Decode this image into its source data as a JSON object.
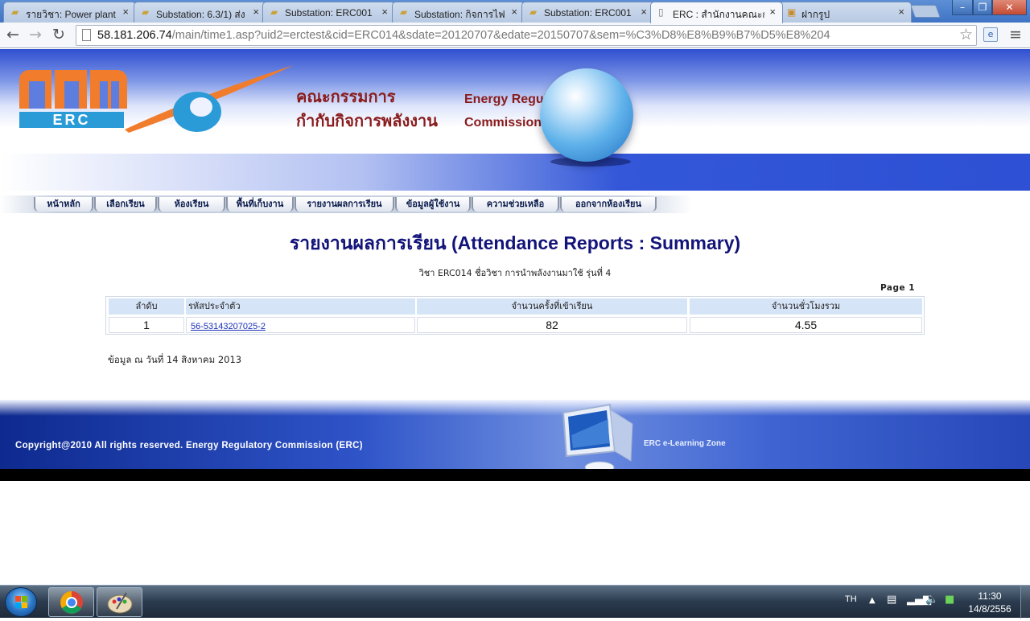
{
  "browser": {
    "tabs": [
      {
        "title": "รายวิชา: Power plant",
        "icon": "folder-icon"
      },
      {
        "title": "Substation: 6.3/1) ส่ง",
        "icon": "folder-icon"
      },
      {
        "title": "Substation: ERC001",
        "icon": "folder-icon"
      },
      {
        "title": "Substation: กิจการไฟ",
        "icon": "folder-icon"
      },
      {
        "title": "Substation: ERC001",
        "icon": "folder-icon"
      },
      {
        "title": "ERC : สำนักงานคณะก",
        "icon": "page-icon"
      },
      {
        "title": "ฝากรูป",
        "icon": "site-icon"
      }
    ],
    "active_tab": 5,
    "close_glyph": "×",
    "window_controls": {
      "minimize": "–",
      "restore": "❐",
      "close": "✕"
    },
    "url_host": "58.181.206.74",
    "url_path": "/main/time1.asp?uid2=erctest&cid=ERC014&sdate=20120707&edate=20150707&sem=%C3%D8%E8%B9%B7%D5%E8%204"
  },
  "header": {
    "logo_text": "ERC",
    "thai_name_line1": "คณะกรรมการ",
    "thai_name_line2": "กำกับกิจการพลังงาน",
    "english_name_line1": "Energy Regulatory",
    "english_name_line2": "Commission Of Thailand"
  },
  "menu": [
    {
      "label": "หน้าหลัก"
    },
    {
      "label": "เลือกเรียน"
    },
    {
      "label": "ห้องเรียน"
    },
    {
      "label": "พื้นที่เก็บงาน"
    },
    {
      "label": "รายงานผลการเรียน"
    },
    {
      "label": "ข้อมูลผู้ใช้งาน"
    },
    {
      "label": "ความช่วยเหลือ"
    },
    {
      "label": "ออกจากห้องเรียน"
    }
  ],
  "report": {
    "title": "รายงานผลการเรียน (Attendance Reports : Summary)",
    "course_line": "วิชา ERC014 ชื่อวิชา การนำพลังงานมาใช้   รุ่นที่ 4",
    "page_label": "Page  1",
    "columns": [
      "ลำดับ",
      "รหัสประจำตัว",
      "จำนวนครั้งที่เข้าเรียน",
      "จำนวนชั่วโมงรวม"
    ],
    "rows": [
      {
        "no": "1",
        "student_id": "56-53143207025-2",
        "sessions": "82",
        "hours": "4.55"
      }
    ],
    "data_as_of": "ข้อมูล ณ วันที่  14  สิงหาคม  2013"
  },
  "footer": {
    "copyright": "Copyright@2010  All  rights  reserved.  Energy  Regulatory  Commission  (ERC)",
    "zone_label": "ERC e-Learning Zone"
  },
  "taskbar": {
    "apps": [
      {
        "name": "chrome-app",
        "icon": "chrome-icon"
      },
      {
        "name": "paint-app",
        "icon": "paint-icon"
      }
    ],
    "language": "TH",
    "time": "11:30",
    "date": "14/8/2556"
  },
  "colors": {
    "title_navy": "#13147a",
    "header_maroon": "#8a1b1b",
    "banner_blue": "#2d50d4",
    "table_header": "#d6e4f7",
    "link_blue": "#1a2fb8"
  }
}
